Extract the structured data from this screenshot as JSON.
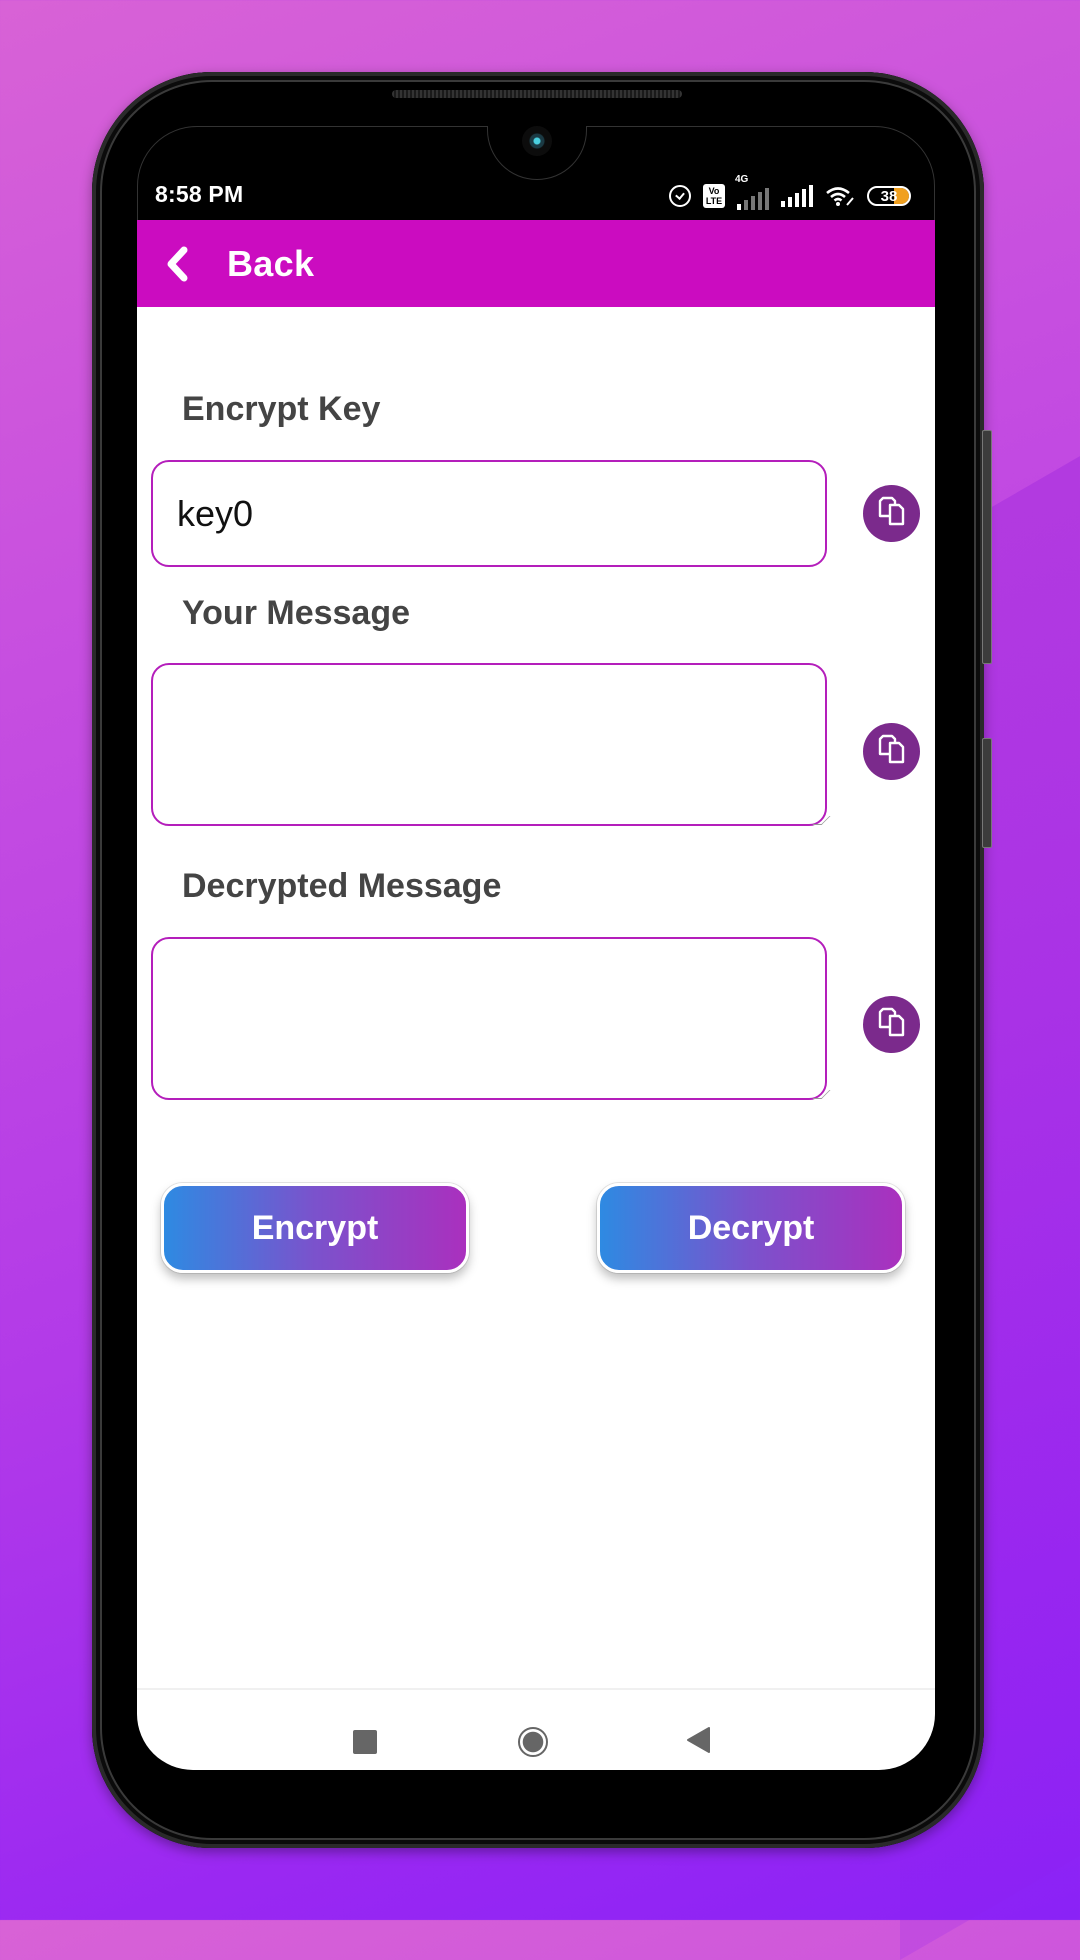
{
  "status_bar": {
    "time": "8:58 PM",
    "network_label": "4G",
    "volte_label_top": "Vo",
    "volte_label_bottom": "LTE",
    "battery_level": "38",
    "icons": [
      "alarm-icon",
      "volte-icon",
      "signal-4g-icon",
      "signal-icon",
      "wifi-icon",
      "battery-icon"
    ]
  },
  "app_bar": {
    "back_label": "Back",
    "back_icon": "chevron-left-icon",
    "color": "#cb0cc0"
  },
  "form": {
    "encrypt_key": {
      "label": "Encrypt Key",
      "value": "key0",
      "copy_icon": "copy-icon"
    },
    "your_message": {
      "label": "Your Message",
      "value": "",
      "copy_icon": "copy-icon"
    },
    "decrypted_message": {
      "label": "Decrypted Message",
      "value": "",
      "copy_icon": "copy-icon"
    },
    "border_color": "#b41ebb",
    "copy_button_color": "#7b2a8c"
  },
  "actions": {
    "encrypt_label": "Encrypt",
    "decrypt_label": "Decrypt",
    "gradient_start": "#2e8ae2",
    "gradient_end": "#aa30be"
  },
  "nav_bar": {
    "items": [
      "recents-square-icon",
      "home-circle-icon",
      "back-triangle-icon"
    ]
  }
}
